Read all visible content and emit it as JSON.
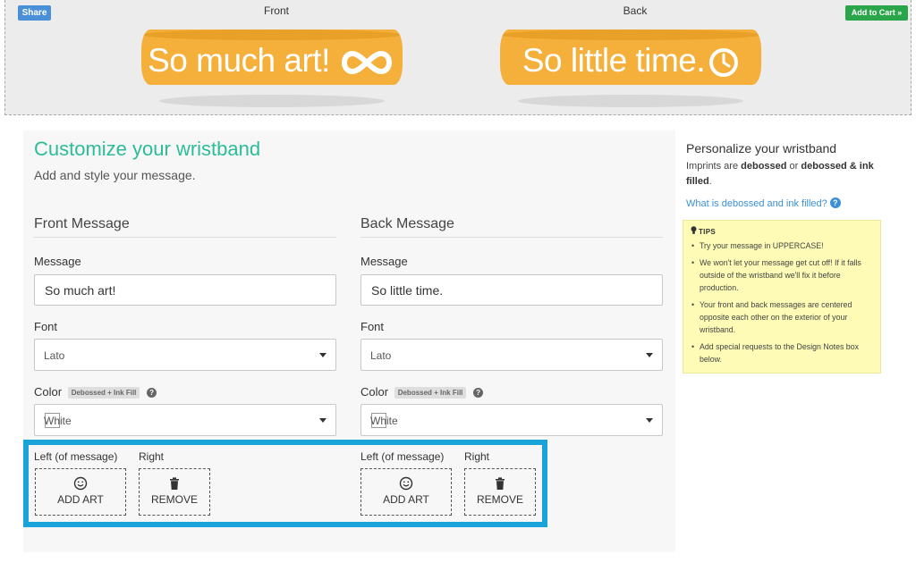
{
  "preview": {
    "share_label": "Share",
    "add_to_cart_label": "Add to Cart »",
    "front_label": "Front",
    "back_label": "Back",
    "front_band_text": "So much art!",
    "back_band_text": "So little time.",
    "front_icon": "infinity-icon",
    "back_icon": "clock-icon"
  },
  "customize": {
    "title": "Customize your wristband",
    "subtitle": "Add and style your message.",
    "front": {
      "heading": "Front Message",
      "message_label": "Message",
      "message_value": "So much art!",
      "font_label": "Font",
      "font_value": "Lato",
      "color_label": "Color",
      "color_badge": "Debossed + Ink Fill",
      "color_value": "White",
      "left_label": "Left (of message)",
      "right_label": "Right",
      "add_art_label": "ADD ART",
      "remove_label": "REMOVE"
    },
    "back": {
      "heading": "Back Message",
      "message_label": "Message",
      "message_value": "So little time.",
      "font_label": "Font",
      "font_value": "Lato",
      "color_label": "Color",
      "color_badge": "Debossed + Ink Fill",
      "color_value": "White",
      "left_label": "Left (of message)",
      "right_label": "Right",
      "add_art_label": "ADD ART",
      "remove_label": "REMOVE"
    }
  },
  "sidebar": {
    "title": "Personalize your wristband",
    "desc_1": "Imprints are ",
    "desc_bold_1": "debossed",
    "desc_2": " or ",
    "desc_bold_2": "debossed & ink filled",
    "desc_3": ".",
    "link": "What is debossed and ink filled?",
    "tips_heading": "TIPS",
    "tips": [
      "Try your message in UPPERCASE!",
      "We won't let your message get cut off! If it falls outside of the wristband we'll fix it before production.",
      "Your front and back messages are centered opposite each other on the exterior of your wristband.",
      "Add special requests to the Design Notes box below."
    ]
  },
  "colors": {
    "accent_title": "#2cbc98",
    "band": "#f5b03c",
    "highlight": "#1aa3d9",
    "cart": "#2aa54a",
    "share": "#4a90d9",
    "link": "#3a8fd6",
    "tips_bg": "#fdfbb5"
  }
}
